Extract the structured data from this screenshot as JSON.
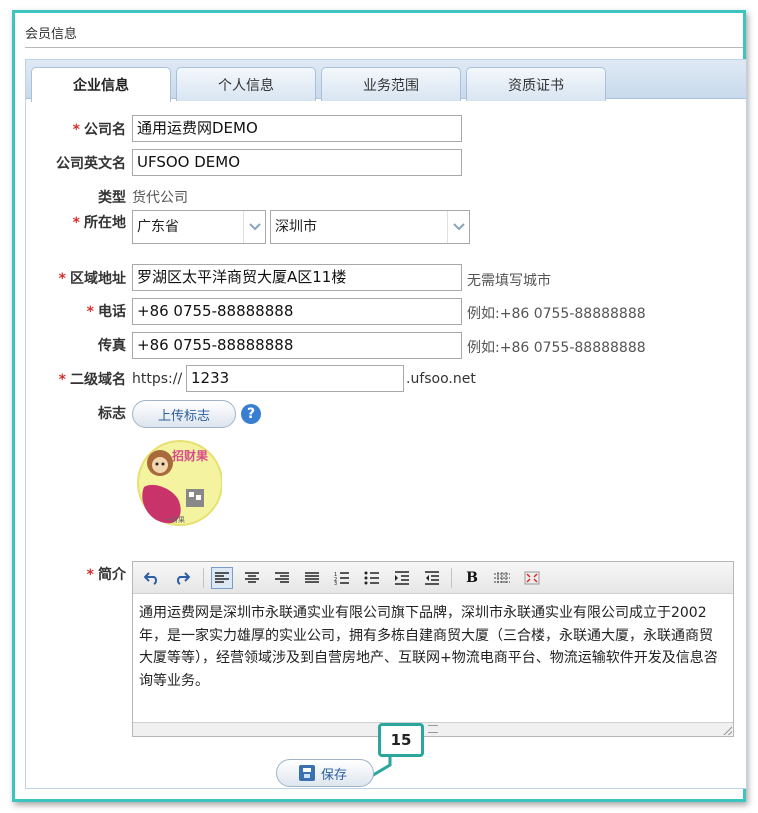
{
  "section": {
    "title": "会员信息"
  },
  "tabs": [
    {
      "label": "企业信息",
      "active": true
    },
    {
      "label": "个人信息",
      "active": false
    },
    {
      "label": "业务范围",
      "active": false
    },
    {
      "label": "资质证书",
      "active": false
    }
  ],
  "form": {
    "required_mark": "*",
    "company_name": {
      "label": "公司名",
      "value": "通用运费网DEMO"
    },
    "company_en_name": {
      "label": "公司英文名",
      "value": "UFSOO DEMO"
    },
    "type": {
      "label": "类型",
      "value": "货代公司"
    },
    "location": {
      "label": "所在地",
      "province": "广东省",
      "city": "深圳市"
    },
    "district_address": {
      "label": "区域地址",
      "value": "罗湖区太平洋商贸大厦A区11楼",
      "hint": "无需填写城市"
    },
    "phone": {
      "label": "电话",
      "value": "+86 0755-88888888",
      "hint": "例如:+86 0755-88888888"
    },
    "fax": {
      "label": "传真",
      "value": "+86 0755-88888888",
      "hint": "例如:+86 0755-88888888"
    },
    "subdomain": {
      "label": "二级域名",
      "prefix": "https://",
      "value": "1233",
      "suffix": ".ufsoo.net"
    },
    "logo": {
      "label": "标志",
      "upload_label": "上传标志",
      "help_glyph": "?",
      "image_text_top": "招财果",
      "image_text_bottom": "一财果"
    },
    "intro": {
      "label": "简介",
      "text": "通用运费网是深圳市永联通实业有限公司旗下品牌，深圳市永联通实业有限公司成立于2002年，是一家实力雄厚的实业公司，拥有多栋自建商贸大厦（三合楼，永联通大厦，永联通商贸大厦等等），经营领域涉及到自营房地产、互联网+物流电商平台、物流运输软件开发及信息咨询等业务。"
    }
  },
  "toolbar_icons": [
    "undo-icon",
    "redo-icon",
    "align-left-icon",
    "align-center-icon",
    "align-right-icon",
    "align-justify-icon",
    "ordered-list-icon",
    "unordered-list-icon",
    "indent-icon",
    "outdent-icon",
    "bold-icon",
    "table-icon",
    "fullscreen-icon"
  ],
  "save": {
    "label": "保存"
  },
  "callout": {
    "number": "15"
  },
  "colors": {
    "frame": "#3cc4c0",
    "required": "#d4302b",
    "callout": "#2aa69f",
    "link_blue": "#2a5f9e"
  }
}
